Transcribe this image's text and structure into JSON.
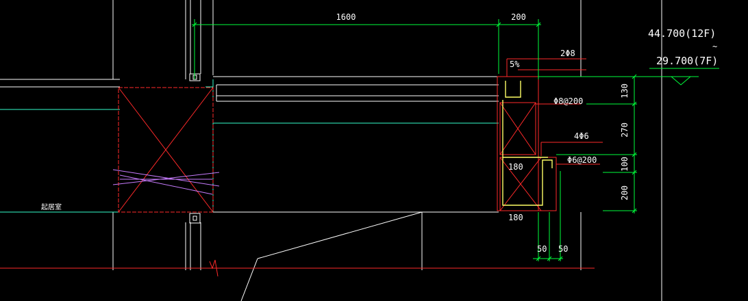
{
  "colors": {
    "background": "#000000",
    "dimension": "#00ff3c",
    "outline": "#ff2a2a",
    "wall": "#ffffff",
    "hatch": "#c87cff",
    "rebar": "#ffff66",
    "text": "#ffffff",
    "level_text": "#ffffff"
  },
  "dimensions": {
    "d1600": "1600",
    "d200_top": "200",
    "d130": "130",
    "d270": "270",
    "d100": "100",
    "d200_side": "200",
    "d180_mid": "180",
    "d180_bot": "180",
    "d50_left": "50",
    "d50_right": "50"
  },
  "rebar_labels": {
    "top_bars": "2Φ8",
    "stirrups": "Φ8@200",
    "small_bars": "4Φ6",
    "small_stirrups": "Φ6@200",
    "slope": "5%"
  },
  "levels": {
    "upper": "44.700(12F)",
    "tilde": "~",
    "lower": "29.700(7F)"
  },
  "room": {
    "name": "起居室"
  }
}
